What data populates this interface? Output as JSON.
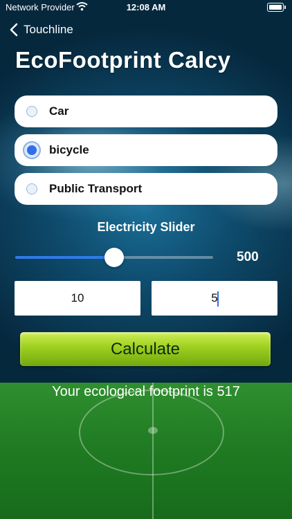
{
  "status_bar": {
    "carrier": "Network Provider",
    "time": "12:08 AM"
  },
  "nav": {
    "back_label": "Touchline"
  },
  "title": "EcoFootprint Calcy",
  "transport_options": [
    {
      "label": "Car",
      "selected": false
    },
    {
      "label": "bicycle",
      "selected": true
    },
    {
      "label": "Public Transport",
      "selected": false
    }
  ],
  "slider": {
    "title": "Electricity Slider",
    "value_text": "500",
    "fill_fraction": 0.5
  },
  "inputs": {
    "first_value": "10",
    "second_value": "5"
  },
  "calculate_label": "Calculate",
  "result_text": "Your ecological footprint is 517",
  "colors": {
    "accent": "#2f7be8",
    "button_green": "#9dcf1f"
  }
}
